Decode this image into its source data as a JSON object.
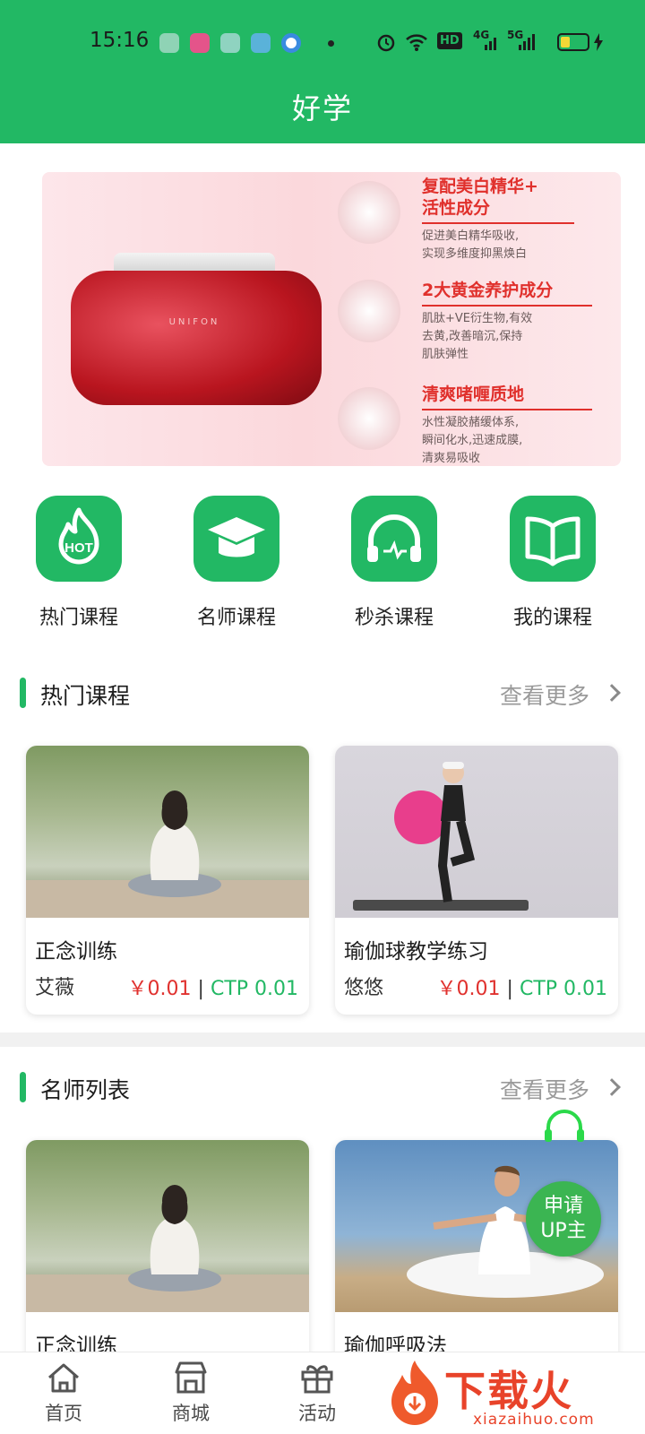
{
  "status_bar": {
    "time": "15:16",
    "network_4g": "4G",
    "network_5g": "5G",
    "hd_label": "HD"
  },
  "header": {
    "title": "好学"
  },
  "banner": {
    "brand": "UNIFON",
    "features": [
      {
        "title": "复配美白精华+\n活性成分",
        "desc": "促进美白精华吸收,\n实现多维度抑黑焕白"
      },
      {
        "title": "2大黄金养护成分",
        "desc": "肌肽+VE衍生物,有效\n去黄,改善暗沉,保持\n肌肤弹性"
      },
      {
        "title": "清爽啫喱质地",
        "desc": "水性凝胶赭缓体系,\n瞬间化水,迅速成膜,\n清爽易吸收"
      }
    ]
  },
  "categories": [
    {
      "label": "热门课程",
      "icon": "hot-flame-icon",
      "badge": "HOT"
    },
    {
      "label": "名师课程",
      "icon": "graduation-cap-icon"
    },
    {
      "label": "秒杀课程",
      "icon": "headphones-icon"
    },
    {
      "label": "我的课程",
      "icon": "open-book-icon"
    }
  ],
  "hot_courses": {
    "title": "热门课程",
    "more": "查看更多",
    "items": [
      {
        "title": "正念训练",
        "author": "艾薇",
        "price_yen": "￥0.01",
        "sep": " | ",
        "price_ctp": "CTP 0.01"
      },
      {
        "title": "瑜伽球教学练习",
        "author": "悠悠",
        "price_yen": "￥0.01",
        "sep": " | ",
        "price_ctp": "CTP 0.01"
      }
    ]
  },
  "teachers": {
    "title": "名师列表",
    "more": "查看更多",
    "items": [
      {
        "title": "正念训练"
      },
      {
        "title": "瑜伽呼吸法"
      }
    ]
  },
  "apply_badge": {
    "line1": "申请",
    "line2": "UP主"
  },
  "bottom_nav": [
    {
      "label": "首页",
      "icon": "home-icon"
    },
    {
      "label": "商城",
      "icon": "shop-icon"
    },
    {
      "label": "活动",
      "icon": "gift-icon"
    }
  ],
  "watermark": {
    "text": "下载火",
    "sub": "xiazaihuo.com"
  },
  "colors": {
    "primary": "#22b864",
    "price_red": "#e0312e",
    "watermark": "#e8432a"
  }
}
